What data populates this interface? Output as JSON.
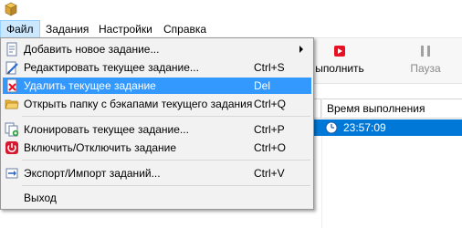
{
  "menubar": {
    "items": [
      "Файл",
      "Задания",
      "Настройки",
      "Справка"
    ]
  },
  "toolbar": {
    "run_label": "ыполнить",
    "pause_label": "Пауза",
    "run_icon_color": "#e81123",
    "pause_icon_color": "#a0a0a0"
  },
  "grid": {
    "columns": [
      "",
      "Время выполнения"
    ],
    "rows": [
      {
        "time": "23:57:09"
      }
    ]
  },
  "file_menu": {
    "items": [
      {
        "icon": "add-task-icon",
        "label": "Добавить новое задание...",
        "shortcut": "",
        "submenu": true
      },
      {
        "icon": "edit-task-icon",
        "label": "Редактировать текущее задание...",
        "shortcut": "Ctrl+S"
      },
      {
        "icon": "delete-task-icon",
        "label": "Удалить текущее задание",
        "shortcut": "Del"
      },
      {
        "icon": "open-folder-icon",
        "label": "Открыть папку с бэкапами текущего задания",
        "shortcut": "Ctrl+Q"
      },
      {
        "icon": "clone-task-icon",
        "label": "Клонировать текущее задание...",
        "shortcut": "Ctrl+P"
      },
      {
        "icon": "power-toggle-icon",
        "label": "Включить/Отключить задание",
        "shortcut": "Ctrl+O"
      },
      {
        "icon": "export-import-icon",
        "label": "Экспорт/Импорт заданий...",
        "shortcut": "Ctrl+V"
      },
      {
        "icon": "",
        "label": "Выход",
        "shortcut": ""
      }
    ],
    "highlight_color": "#3399ff"
  }
}
